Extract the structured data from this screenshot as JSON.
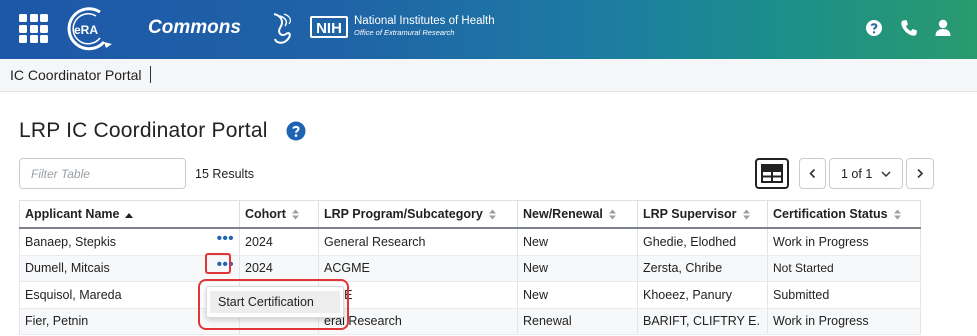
{
  "header": {
    "app_name": "Commons",
    "era_logo_text": "eRA",
    "nih_badge": "NIH",
    "nih_line1": "National Institutes of Health",
    "nih_line2": "Office of Extramural Research",
    "icons": [
      "apps-grid-icon",
      "help-icon",
      "phone-icon",
      "user-icon"
    ]
  },
  "portal_bar": {
    "label": "IC Coordinator Portal"
  },
  "page": {
    "title": "LRP IC Coordinator Portal"
  },
  "toolbar": {
    "filter_placeholder": "Filter Table",
    "filter_value": "",
    "results": "15 Results",
    "page_select": "1 of 1"
  },
  "table": {
    "columns": [
      "Applicant Name",
      "Cohort",
      "LRP Program/Subcategory",
      "New/Renewal",
      "LRP Supervisor",
      "Certification Status"
    ],
    "rows": [
      {
        "applicant": "Banaep, Stepkis",
        "cohort": "2024",
        "program": "General Research",
        "new_renewal": "New",
        "supervisor": "Ghedie, Elodhed",
        "status": "Work in Progress"
      },
      {
        "applicant": "Dumell, Mitcais",
        "cohort": "2024",
        "program": "ACGME",
        "new_renewal": "New",
        "supervisor": "Zersta, Chribe",
        "status": "Not Started"
      },
      {
        "applicant": "Esquisol, Mareda",
        "cohort": "",
        "program": "GME",
        "new_renewal": "New",
        "supervisor": "Khoeez, Panury",
        "status": "Submitted"
      },
      {
        "applicant": "Fier, Petnin",
        "cohort": "",
        "program": "eral Research",
        "new_renewal": "Renewal",
        "supervisor": "BARIFT, CLIFTRY E.",
        "status": "Work in Progress"
      }
    ],
    "row_actions_label": "•••"
  },
  "context_menu": {
    "items": [
      "Start Certification"
    ]
  },
  "colors": {
    "accent": "#1f63b3",
    "highlight": "#e1353a"
  }
}
